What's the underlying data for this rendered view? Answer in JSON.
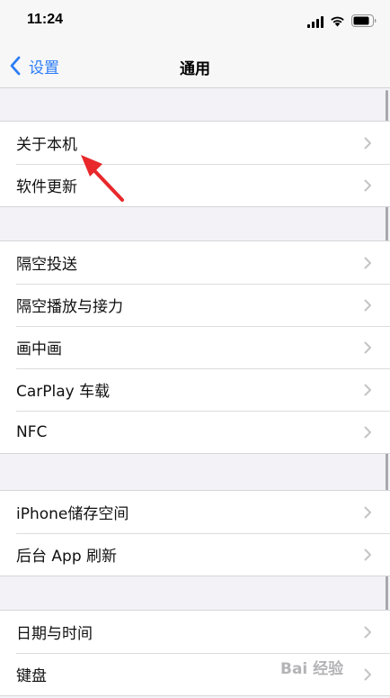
{
  "status_bar": {
    "time": "11:24"
  },
  "nav": {
    "back_label": "设置",
    "title": "通用"
  },
  "groups": [
    {
      "items": [
        {
          "label": "关于本机"
        },
        {
          "label": "软件更新"
        }
      ]
    },
    {
      "items": [
        {
          "label": "隔空投送"
        },
        {
          "label": "隔空播放与接力"
        },
        {
          "label": "画中画"
        },
        {
          "label": "CarPlay 车载"
        },
        {
          "label": "NFC"
        }
      ]
    },
    {
      "items": [
        {
          "label": "iPhone储存空间"
        },
        {
          "label": "后台 App 刷新"
        }
      ]
    },
    {
      "items": [
        {
          "label": "日期与时间"
        },
        {
          "label": "键盘"
        }
      ]
    }
  ],
  "watermark": {
    "text": "Bai 经验"
  },
  "colors": {
    "accent": "#2c7cf6",
    "background": "#f2f2f7",
    "annotation_arrow": "#e8282b"
  }
}
